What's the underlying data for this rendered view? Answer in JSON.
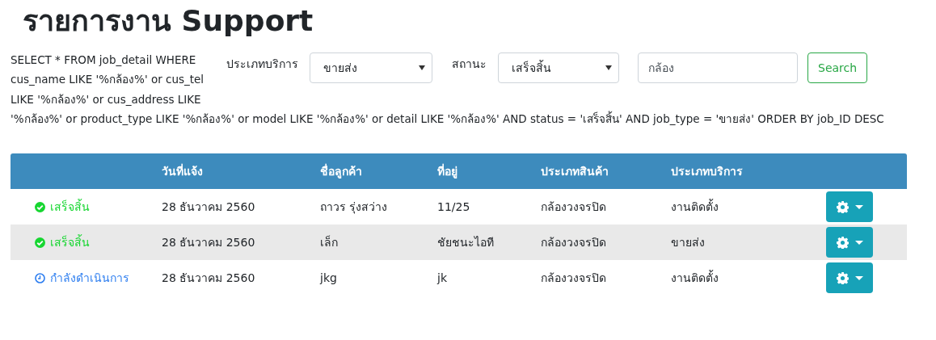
{
  "page": {
    "title": "รายการงาน Support"
  },
  "query_text": [
    "SELECT * FROM job_detail WHERE cus_name LIKE '%กล้อง%' or cus_tel LIKE '%กล้อง%' or cus_address LIKE",
    "'%กล้อง%' or product_type LIKE '%กล้อง%' or model LIKE '%กล้อง%' or detail LIKE '%กล้อง%' AND status = 'เสร็จสิ้น' AND job_type = 'ขายส่ง' ORDER BY job_ID DESC"
  ],
  "filters": {
    "service_type_label": "ประเภทบริการ",
    "service_type_value": "ขายส่ง",
    "status_label": "สถานะ",
    "status_value": "เสร็จสิ้น",
    "search_value": "กล้อง",
    "search_button": "Search"
  },
  "table": {
    "columns": [
      "วันที่แจ้ง",
      "ชื่อลูกค้า",
      "ที่อยู่",
      "ประเภทสินค้า",
      "ประเภทบริการ"
    ],
    "rows": [
      {
        "status": {
          "kind": "done",
          "label": "เสร็จสิ้น"
        },
        "date": "28 ธันวาคม 2560",
        "customer": "ถาวร รุ่งสว่าง",
        "address": "11/25",
        "product_type": "กล้องวงจรปิด",
        "service_type": "งานติดตั้ง"
      },
      {
        "status": {
          "kind": "done",
          "label": "เสร็จสิ้น"
        },
        "date": "28 ธันวาคม 2560",
        "customer": "เล็ก",
        "address": "ชัยชนะไอที",
        "product_type": "กล้องวงจรปิด",
        "service_type": "ขายส่ง"
      },
      {
        "status": {
          "kind": "in_progress",
          "label": "กำลังดำเนินการ"
        },
        "date": "28 ธันวาคม 2560",
        "customer": "jkg",
        "address": "jk",
        "product_type": "กล้องวงจรปิด",
        "service_type": "งานติดตั้ง"
      }
    ]
  }
}
